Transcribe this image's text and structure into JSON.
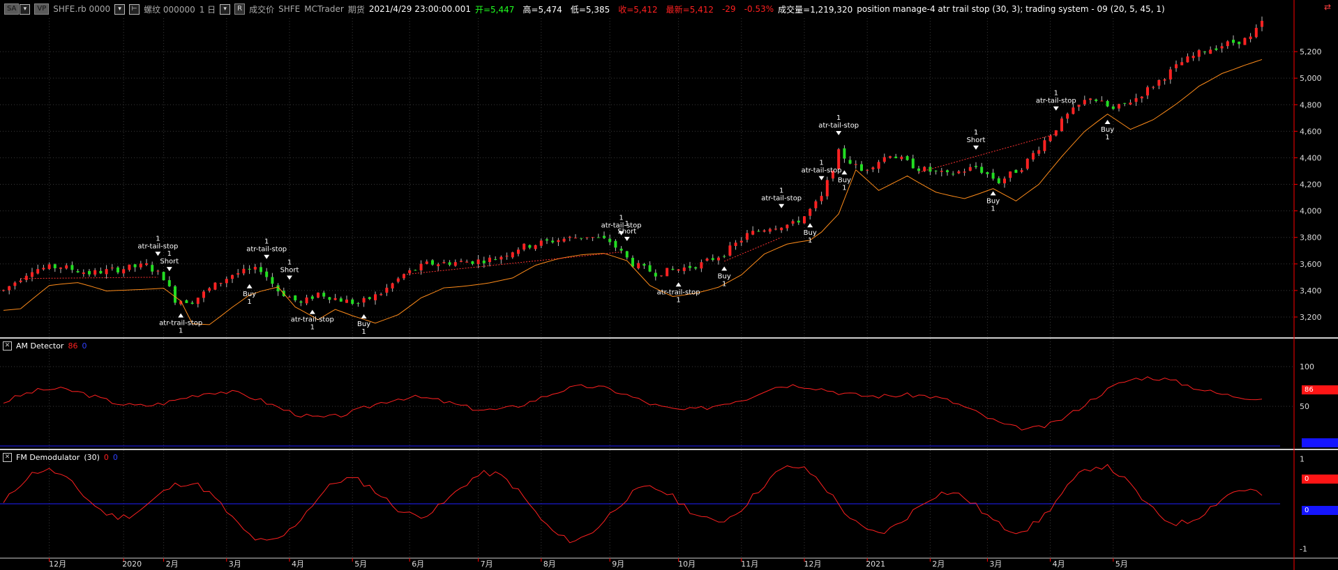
{
  "toolbar": {
    "sa_btn": "SA",
    "vp_btn": "VP",
    "symbol": "SHFE.rb 0000",
    "contract": "螺纹 000000",
    "interval": "1 日",
    "r_btn": "R",
    "price_type": "成交价",
    "exchange": "SHFE",
    "datafeed": "MCTrader",
    "category": "期货",
    "datetime": "2021/4/29",
    "time": "23:00:00.001",
    "open": "开=5,447",
    "high": "高=5,474",
    "low": "低=5,385",
    "close": "收=5,412",
    "last": "最新=5,412",
    "change": "-29",
    "change_pct": "-0.53%",
    "volume": "成交量=1,219,320",
    "strategies": "position manage-4 atr trail stop (30,  3); trading system - 09 (20,  5,  45,  1)"
  },
  "panels": {
    "am": {
      "title": "AM Detector",
      "v1": "86",
      "v2": "0",
      "tag1": "86"
    },
    "fm": {
      "title": "FM Demodulator",
      "param": "(30)",
      "v1": "0",
      "v2": "0",
      "tag1": "0",
      "tag2": "0"
    }
  },
  "colors": {
    "up": "#ff2222",
    "down": "#22dd22",
    "stop": "#ff8c1a",
    "am": "#ff2020",
    "zero": "#2020ff",
    "axis": "#ff0000"
  },
  "chart_data": {
    "type": "candlestick",
    "x_months": [
      "12月",
      "2020",
      "2月",
      "3月",
      "4月",
      "5月",
      "6月",
      "7月",
      "8月",
      "9月",
      "10月",
      "11月",
      "12月",
      "2021",
      "2月",
      "3月",
      "4月",
      "5月"
    ],
    "y_ticks": [
      "5,200",
      "5,000",
      "4,800",
      "4,600",
      "4,400",
      "4,200",
      "4,000",
      "3,800",
      "3,600",
      "3,400",
      "3,200"
    ],
    "y_range": [
      3100,
      5400
    ],
    "price_path": [
      [
        0,
        3400
      ],
      [
        5,
        3560
      ],
      [
        10,
        3580
      ],
      [
        15,
        3530
      ],
      [
        20,
        3560
      ],
      [
        25,
        3590
      ],
      [
        28,
        3500
      ],
      [
        30,
        3330
      ],
      [
        33,
        3320
      ],
      [
        37,
        3440
      ],
      [
        40,
        3520
      ],
      [
        42,
        3540
      ],
      [
        45,
        3560
      ],
      [
        48,
        3400
      ],
      [
        52,
        3300
      ],
      [
        55,
        3380
      ],
      [
        58,
        3340
      ],
      [
        62,
        3300
      ],
      [
        66,
        3380
      ],
      [
        70,
        3520
      ],
      [
        74,
        3600
      ],
      [
        78,
        3610
      ],
      [
        82,
        3620
      ],
      [
        86,
        3640
      ],
      [
        90,
        3720
      ],
      [
        94,
        3760
      ],
      [
        98,
        3790
      ],
      [
        102,
        3810
      ],
      [
        106,
        3770
      ],
      [
        110,
        3600
      ],
      [
        114,
        3530
      ],
      [
        118,
        3560
      ],
      [
        122,
        3600
      ],
      [
        126,
        3680
      ],
      [
        130,
        3820
      ],
      [
        134,
        3880
      ],
      [
        138,
        3900
      ],
      [
        140,
        3960
      ],
      [
        143,
        4100
      ],
      [
        146,
        4440
      ],
      [
        150,
        4300
      ],
      [
        155,
        4430
      ],
      [
        160,
        4320
      ],
      [
        165,
        4270
      ],
      [
        170,
        4330
      ],
      [
        174,
        4220
      ],
      [
        178,
        4330
      ],
      [
        182,
        4530
      ],
      [
        186,
        4720
      ],
      [
        190,
        4860
      ],
      [
        194,
        4760
      ],
      [
        198,
        4850
      ],
      [
        202,
        4980
      ],
      [
        206,
        5120
      ],
      [
        210,
        5210
      ],
      [
        214,
        5260
      ],
      [
        218,
        5300
      ],
      [
        220,
        5420
      ]
    ],
    "signals": [
      {
        "i": 27,
        "label": "atr-tail-stop",
        "count": "1",
        "dir": "down"
      },
      {
        "i": 29,
        "label": "Short",
        "count": "1",
        "dir": "down"
      },
      {
        "i": 31,
        "label": "atr-trail-stop",
        "count": "1",
        "dir": "up"
      },
      {
        "i": 46,
        "label": "atr-tail-stop",
        "count": "1",
        "dir": "down"
      },
      {
        "i": 43,
        "label": "Buy",
        "count": "1",
        "dir": "up"
      },
      {
        "i": 50,
        "label": "Short",
        "count": "1",
        "dir": "down"
      },
      {
        "i": 54,
        "label": "atr-trail-stop",
        "count": "1",
        "dir": "up"
      },
      {
        "i": 63,
        "label": "Buy",
        "count": "1",
        "dir": "up"
      },
      {
        "i": 108,
        "label": "atr-tail-stop",
        "count": "1",
        "dir": "down"
      },
      {
        "i": 109,
        "label": "Short",
        "count": "1",
        "dir": "down"
      },
      {
        "i": 118,
        "label": "atr-trail-stop",
        "count": "1",
        "dir": "up"
      },
      {
        "i": 126,
        "label": "Buy",
        "count": "1",
        "dir": "up"
      },
      {
        "i": 136,
        "label": "atr-tail-stop",
        "count": "1",
        "dir": "down"
      },
      {
        "i": 141,
        "label": "Buy",
        "count": "1",
        "dir": "up"
      },
      {
        "i": 143,
        "label": "atr-tail-stop",
        "count": "1",
        "dir": "down"
      },
      {
        "i": 147,
        "label": "Buy",
        "count": "1",
        "dir": "up"
      },
      {
        "i": 146,
        "label": "atr-tail-stop",
        "count": "1",
        "dir": "down"
      },
      {
        "i": 170,
        "label": "Short",
        "count": "1",
        "dir": "down"
      },
      {
        "i": 173,
        "label": "Buy",
        "count": "1",
        "dir": "up"
      },
      {
        "i": 184,
        "label": "atr-tail-stop",
        "count": "1",
        "dir": "down"
      },
      {
        "i": 193,
        "label": "Buy",
        "count": "1",
        "dir": "up"
      }
    ],
    "am_ticks": [
      "100",
      "50"
    ],
    "am_range": [
      0,
      130
    ],
    "fm_ticks": [
      "1",
      "-1"
    ],
    "fm_range": [
      -1.1,
      1.1
    ]
  }
}
